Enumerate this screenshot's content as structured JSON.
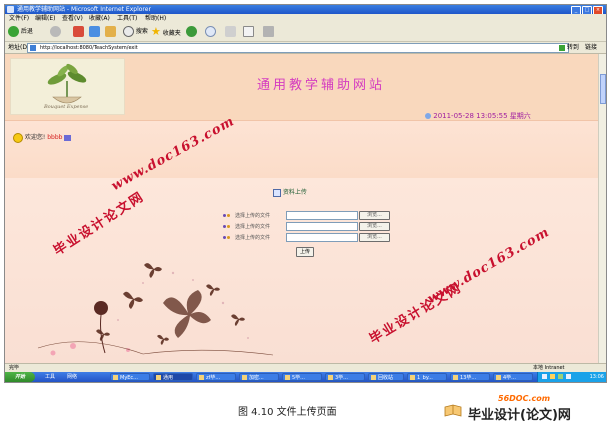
{
  "window": {
    "title": "通用教学辅助网站 - Microsoft Internet Explorer"
  },
  "menu": [
    "文件(F)",
    "编辑(E)",
    "查看(V)",
    "收藏(A)",
    "工具(T)",
    "帮助(H)"
  ],
  "toolbar": {
    "back": "后退",
    "search": "搜索",
    "favorites": "收藏夹"
  },
  "address": {
    "label": "地址(D)",
    "url": "http://localhost:8080/TeachSystem/exit",
    "go": "转到",
    "links": "链接"
  },
  "header": {
    "logo_text": "Bouquet Expense",
    "site_title": "通用教学辅助网站",
    "datetime": "2011-05-28 13:05:55 星期六"
  },
  "user": {
    "welcome": "欢迎您!",
    "username": "bbbb"
  },
  "upload": {
    "title": "资料上传",
    "rows": [
      {
        "label": "选择上传的文件",
        "button": "浏览..."
      },
      {
        "label": "选择上传的文件",
        "button": "浏览..."
      },
      {
        "label": "选择上传的文件",
        "button": "浏览..."
      }
    ],
    "submit": "上传"
  },
  "status": {
    "left": "完毕",
    "right": "本地 Intranet"
  },
  "taskbar": {
    "start": "开始",
    "quick": [
      "工具",
      "网络"
    ],
    "buttons": [
      "MyEc...",
      "通用",
      "zf毕...",
      "加密...",
      "5毕...",
      "3毕...",
      "回收站",
      "1_by...",
      "13毕...",
      "4毕..."
    ],
    "clock": "13:06"
  },
  "watermarks": {
    "url": "www.doc163.com",
    "text": "毕业设计论文网"
  },
  "figure": {
    "caption": "图 4.10  文件上传页面"
  },
  "brand": {
    "site": "56DOC.com",
    "name": "毕业设计(论文)网"
  }
}
